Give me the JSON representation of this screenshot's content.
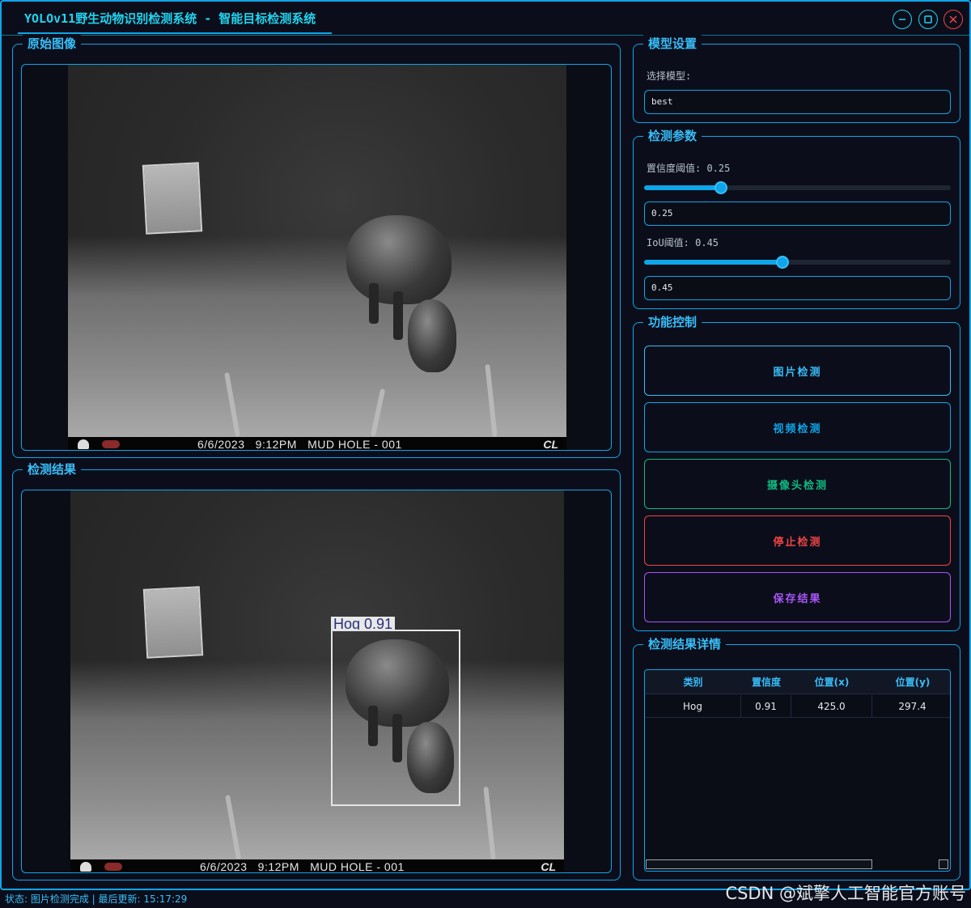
{
  "window": {
    "title": "YOLOv11野生动物识别检测系统 - 智能目标检测系统"
  },
  "panels": {
    "original": {
      "title": "原始图像",
      "overlay": {
        "date_text": "6/6/2023   9:12PM   MUD HOLE - 001",
        "brand": "CL"
      }
    },
    "result": {
      "title": "检测结果",
      "overlay": {
        "date_text": "6/6/2023   9:12PM   MUD HOLE - 001",
        "brand": "CL"
      },
      "detection_label": "Hog 0.91"
    }
  },
  "model_settings": {
    "title": "模型设置",
    "select_label": "选择模型:",
    "selected_model": "best"
  },
  "detection_params": {
    "title": "检测参数",
    "confidence_label": "置信度阈值: 0.25",
    "confidence_value": "0.25",
    "confidence_level": 0.25,
    "iou_label": "IoU阈值: 0.45",
    "iou_value": "0.45",
    "iou_level": 0.45
  },
  "controls": {
    "title": "功能控制",
    "image_detect": "图片检测",
    "video_detect": "视频检测",
    "camera_detect": "摄像头检测",
    "stop_detect": "停止检测",
    "save_results": "保存结果",
    "colors": {
      "image": "#38bdf8",
      "video": "#0ea5e9",
      "camera": "#10b981",
      "stop": "#ef4444",
      "save": "#a855f7"
    }
  },
  "results_detail": {
    "title": "检测结果详情",
    "columns": [
      "类别",
      "置信度",
      "位置(x)",
      "位置(y)"
    ],
    "rows": [
      [
        "Hog",
        "0.91",
        "425.0",
        "297.4"
      ]
    ]
  },
  "statusbar": {
    "text": "状态: 图片检测完成 | 最后更新: 15:17:29"
  },
  "watermark": "CSDN @斌擎人工智能官方账号"
}
